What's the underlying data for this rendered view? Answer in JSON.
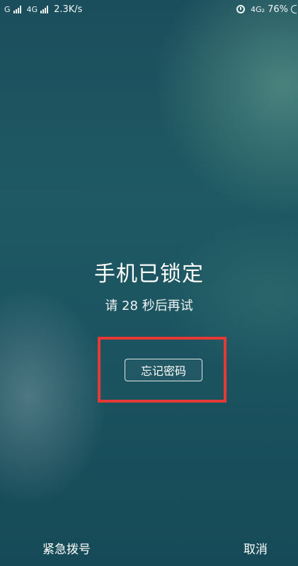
{
  "status_bar": {
    "carrier1": "G",
    "carrier2": "4G",
    "speed": "2.3K/s",
    "network_right": "4G₂",
    "battery": "76%",
    "icons": [
      "signal-icon",
      "signal-icon",
      "alarm-clock-icon",
      "battery-icon"
    ]
  },
  "lock": {
    "title": "手机已锁定",
    "retry_prefix": "请",
    "seconds": "28",
    "retry_suffix": "秒后再试"
  },
  "forgot_password": {
    "label": "忘记密码",
    "highlight_color": "#e53935"
  },
  "bottom": {
    "emergency_label": "紧急拨号",
    "cancel_label": "取消"
  }
}
